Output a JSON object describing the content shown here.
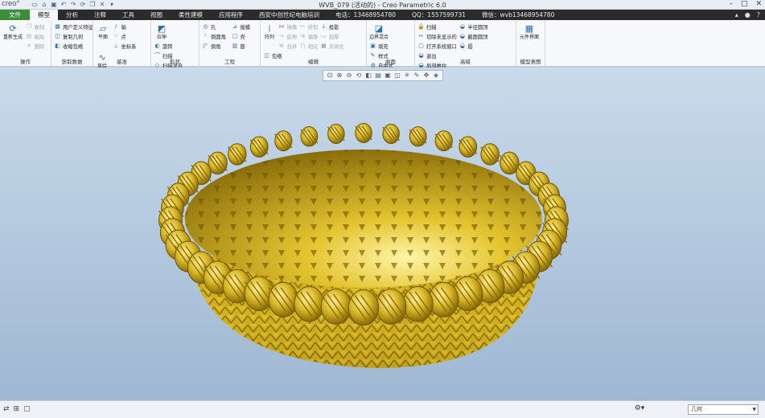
{
  "app": {
    "logo": "creo°",
    "window_title": "WVB_079 (活动的) - Creo Parametric 6.0",
    "qat_icons": [
      "new-icon",
      "open-icon",
      "save-icon",
      "undo-icon",
      "redo-icon",
      "regenerate-icon",
      "windows-icon",
      "close-icon",
      "customize-icon"
    ],
    "window_buttons": [
      "–",
      "□",
      "✕"
    ]
  },
  "tabs": [
    {
      "label": "文件"
    },
    {
      "label": "模型"
    },
    {
      "label": "分析"
    },
    {
      "label": "注释"
    },
    {
      "label": "工具"
    },
    {
      "label": "视图"
    },
    {
      "label": "柔性建模"
    },
    {
      "label": "应用程序"
    },
    {
      "label": "西安中创世纪电脑培训"
    },
    {
      "label": "电话：13468954780"
    },
    {
      "label": "QQ：1557599731"
    },
    {
      "label": "微信：wvb13468954780"
    }
  ],
  "ribbon": {
    "ops": {
      "name": "操作",
      "regen": "重新生成",
      "items": [
        "复制",
        "粘贴",
        "删除"
      ]
    },
    "getdata": {
      "name": "获取数据",
      "items": [
        "用户定义特征",
        "复制几何",
        "收缩包络"
      ]
    },
    "datum": {
      "name": "基准",
      "plane": "平面",
      "items": [
        "轴",
        "点",
        "坐标系"
      ],
      "sketch": "草绘"
    },
    "shapes": {
      "name": "形状",
      "extrude": "拉伸",
      "items": [
        "旋转",
        "扫描",
        "扫描混合"
      ]
    },
    "eng": {
      "name": "工程",
      "col1": [
        "孔",
        "倒圆角",
        "倒角"
      ],
      "col2": [
        "拔模",
        "壳",
        "筋"
      ]
    },
    "edit": {
      "name": "编辑",
      "pattern": "阵列",
      "col1": [
        "镜像",
        "延伸",
        "合并"
      ],
      "col2": [
        "修剪",
        "偏移",
        "相交"
      ],
      "col3": [
        "投影",
        "加厚",
        "实体化"
      ],
      "col4": [
        "包络"
      ]
    },
    "surf": {
      "name": "曲面",
      "boundary": "边界混合",
      "items": [
        "填充",
        "样式",
        "自由式"
      ]
    },
    "adv": {
      "name": "高级",
      "col1": [
        "扫描",
        "切除未显示的",
        "打开系统窗口"
      ],
      "col2": [
        "半径圆顶",
        "截面圆顶",
        "唇"
      ],
      "col3": [
        "退出",
        "局部推拉"
      ]
    },
    "intent": {
      "name": "模型意图",
      "comp": "元件界面"
    }
  },
  "view_toolbar_icons": [
    "refit-icon",
    "zoom-in-icon",
    "zoom-out-icon",
    "repaint-icon",
    "display-style-icon",
    "saved-views-icon",
    "view-manager-icon",
    "perspective-icon",
    "datum-display-icon",
    "annotation-icon",
    "spin-center-icon",
    "appearance-icon"
  ],
  "status": {
    "left_icons": [
      "link-icon",
      "graphics-icon",
      "page-icon"
    ],
    "filter_value": "几何"
  },
  "colors": {
    "basket": "#d4b21e",
    "background_top": "#c9daea",
    "background_bottom": "#9fb7d2",
    "file_tab": "#3c8c3c"
  }
}
